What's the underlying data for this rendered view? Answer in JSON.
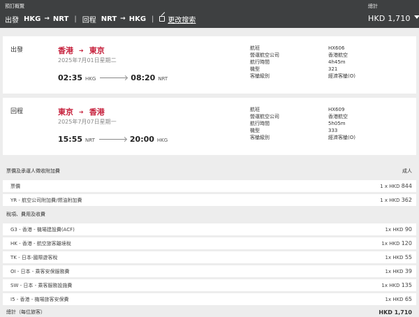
{
  "header": {
    "title": "預訂概覽",
    "total_label": "總計",
    "outbound_label": "出發",
    "outbound_from": "HKG",
    "outbound_to": "NRT",
    "return_label": "回程",
    "return_from": "NRT",
    "return_to": "HKG",
    "edit_label": "更改搜索",
    "total_value": "HKD 1,710"
  },
  "flights": [
    {
      "direction": "出發",
      "from_city": "香港",
      "to_city": "東京",
      "date": "2025年7月01日星期二",
      "depart_time": "02:35",
      "depart_code": "HKG",
      "arrive_time": "08:20",
      "arrive_code": "NRT",
      "details": [
        {
          "label": "航班",
          "value": "HX606"
        },
        {
          "label": "營運航空公司",
          "value": "香港航空"
        },
        {
          "label": "航行時間",
          "value": "4h45m"
        },
        {
          "label": "機型",
          "value": "321"
        },
        {
          "label": "客艙級別",
          "value": "經濟客艙(O)"
        }
      ]
    },
    {
      "direction": "回程",
      "from_city": "東京",
      "to_city": "香港",
      "date": "2025年7月07日星期一",
      "depart_time": "15:55",
      "depart_code": "NRT",
      "arrive_time": "20:00",
      "arrive_code": "HKG",
      "details": [
        {
          "label": "航班",
          "value": "HX609"
        },
        {
          "label": "營運航空公司",
          "value": "香港航空"
        },
        {
          "label": "航行時間",
          "value": "5h05m"
        },
        {
          "label": "機型",
          "value": "333"
        },
        {
          "label": "客艙級別",
          "value": "經濟客艙(O)"
        }
      ]
    }
  ],
  "fare": {
    "section_title": "票價及承運人徵收附加費",
    "column_label": "成人",
    "rows": [
      {
        "label": "票價",
        "amount": "1 x HKD",
        "value": "844"
      },
      {
        "label": "YR - 航空公司附加費/燃油附加費",
        "amount": "1 x HKD",
        "value": "362"
      }
    ]
  },
  "taxes": {
    "section_title": "稅項、費用及收費",
    "rows": [
      {
        "label": "G3 - 香港 - 機場建設費(ACF)",
        "amount": "1x HKD",
        "value": "90"
      },
      {
        "label": "HK - 香港 - 航空旅客離境稅",
        "amount": "1x HKD",
        "value": "120"
      },
      {
        "label": "TK - 日本-國際遊客稅",
        "amount": "1x HKD",
        "value": "55"
      },
      {
        "label": "OI - 日本 - 乘客安保服務費",
        "amount": "1x HKD",
        "value": "39"
      },
      {
        "label": "SW - 日本 - 乘客服務設施費",
        "amount": "1x HKD",
        "value": "135"
      },
      {
        "label": "I5 - 香港 - 機場旅客安保費",
        "amount": "1x HKD",
        "value": "65"
      }
    ]
  },
  "summary": {
    "label": "總計（每位旅客）",
    "value": "HKD 1,710"
  }
}
